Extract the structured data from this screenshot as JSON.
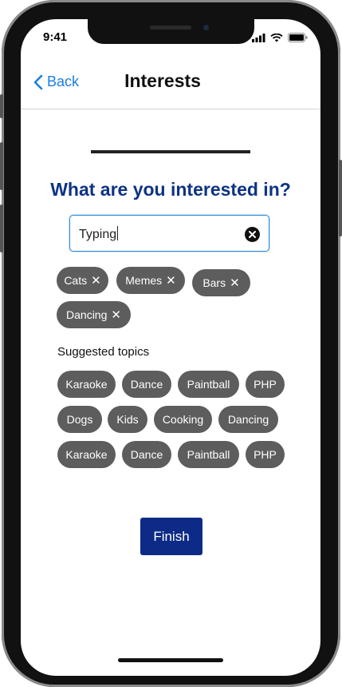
{
  "status_bar": {
    "time": "9:41"
  },
  "nav": {
    "back_label": "Back",
    "title": "Interests"
  },
  "main": {
    "heading": "What are you interested in?",
    "search": {
      "value": "Typing"
    },
    "selected_chips": [
      {
        "label": "Cats"
      },
      {
        "label": "Memes"
      },
      {
        "label": "Bars"
      },
      {
        "label": "Dancing"
      }
    ],
    "remove_glyph": "✕",
    "suggested_label": "Suggested topics",
    "suggested_chips": [
      "Karaoke",
      "Dance",
      "Paintball",
      "PHP",
      "Dogs",
      "Kids",
      "Cooking",
      "Dancing",
      "Karaoke",
      "Dance",
      "Paintball",
      "PHP"
    ],
    "finish_label": "Finish"
  },
  "colors": {
    "accent": "#1a7fe0",
    "heading": "#0d3384",
    "chip": "#5d5d5d",
    "button": "#0d2b86"
  },
  "icons": [
    "chevron-left-icon",
    "signal-icon",
    "wifi-icon",
    "battery-icon",
    "clear-icon"
  ]
}
